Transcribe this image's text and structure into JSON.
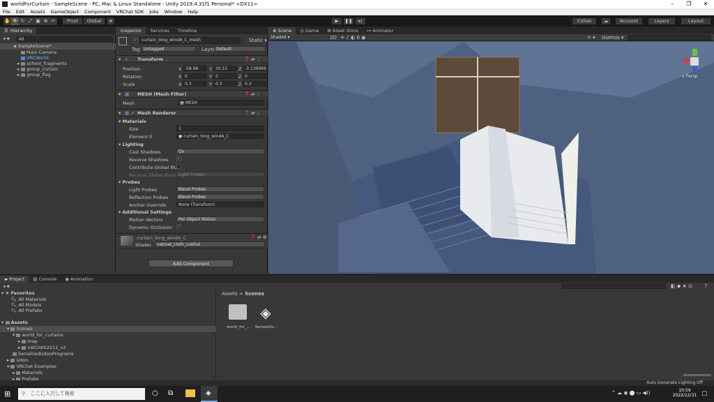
{
  "title": "worldForCurtain - SampleScene - PC, Mac & Linux Standalone - Unity 2019.4.31f1 Personal* <DX11>",
  "menu": [
    "File",
    "Edit",
    "Assets",
    "GameObject",
    "Component",
    "VRChat SDK",
    "Jobs",
    "Window",
    "Help"
  ],
  "toolbar": {
    "pivot": "Pivot",
    "global": "Global",
    "collab": "Collab",
    "account": "Account",
    "layers": "Layers",
    "layout": "Layout"
  },
  "hierarchy": {
    "tab": "Hierarchy",
    "search_placeholder": "All",
    "scene": "SampleScene*",
    "items": [
      "Main Camera",
      "VRCWorld",
      "school_fragments",
      "group_curtain",
      "group_flag"
    ]
  },
  "inspector": {
    "tabs": [
      "Inspector",
      "Services",
      "Timeline"
    ],
    "object_name": "curtain_long_windA_C_mesh",
    "static": "Static",
    "tag_label": "Tag",
    "tag": "Untagged",
    "layer_label": "Layer",
    "layer": "Default",
    "transform": {
      "title": "Transform",
      "position_label": "Position",
      "rotation_label": "Rotation",
      "scale_label": "Scale",
      "position": [
        "-58.98",
        "30.15",
        "-3.139999"
      ],
      "rotation": [
        "0",
        "0",
        "0"
      ],
      "scale": [
        "0.3",
        "0.3",
        "0.3"
      ]
    },
    "mesh_filter": {
      "title": "MESH (Mesh Filter)",
      "mesh_label": "Mesh",
      "mesh": "MESH"
    },
    "mesh_renderer": {
      "title": "Mesh Renderer",
      "materials": "Materials",
      "size_label": "Size",
      "size": "1",
      "element0_label": "Element 0",
      "element0": "curtain_long_windA_C",
      "lighting": "Lighting",
      "cast_shadows_label": "Cast Shadows",
      "cast_shadows": "On",
      "receive_shadows_label": "Receive Shadows",
      "cgi_label": "Contribute Global Illum",
      "rgi_label": "Receive Global Illumin",
      "rgi": "Light Probes",
      "probes": "Probes",
      "light_probes_label": "Light Probes",
      "light_probes": "Blend Probes",
      "reflection_probes_label": "Reflection Probes",
      "reflection_probes": "Blend Probes",
      "anchor_label": "Anchor Override",
      "anchor": "None (Transform)",
      "additional": "Additional Settings",
      "motion_label": "Motion Vectors",
      "motion": "Per Object Motion",
      "occlusion_label": "Dynamic Occlusion"
    },
    "material": {
      "name": "curtain_long_windA_C",
      "shader_label": "Shader",
      "shader": "vat/vat_cloth_cutOut"
    },
    "add_component": "Add Component"
  },
  "scene_view": {
    "tabs": [
      "Scene",
      "Game",
      "Asset Store",
      "Animator"
    ],
    "shading": "Shaded",
    "mode": "2D",
    "gizmos": "Gizmos",
    "persp": "< Persp"
  },
  "project": {
    "tabs": [
      "Project",
      "Console",
      "Animation"
    ],
    "favorites": "Favorites",
    "fav_items": [
      "All Materials",
      "All Models",
      "All Prefabs"
    ],
    "assets": "Assets",
    "tree": [
      "Scenes",
      "world_for_curtains",
      "map",
      "vatCloth2211_v2",
      "SerializedUdonPrograms",
      "Udon",
      "VRChat Examples",
      "Materials",
      "Prefabs"
    ],
    "breadcrumb_root": "Assets",
    "breadcrumb_leaf": "Scenes",
    "files": [
      "world_for_...",
      "SampleSc..."
    ],
    "count": "7"
  },
  "status": "Auto Generate Lighting Off",
  "taskbar": {
    "search": "ここに入力して検索",
    "time": "10:59",
    "date": "2022/12/31"
  }
}
